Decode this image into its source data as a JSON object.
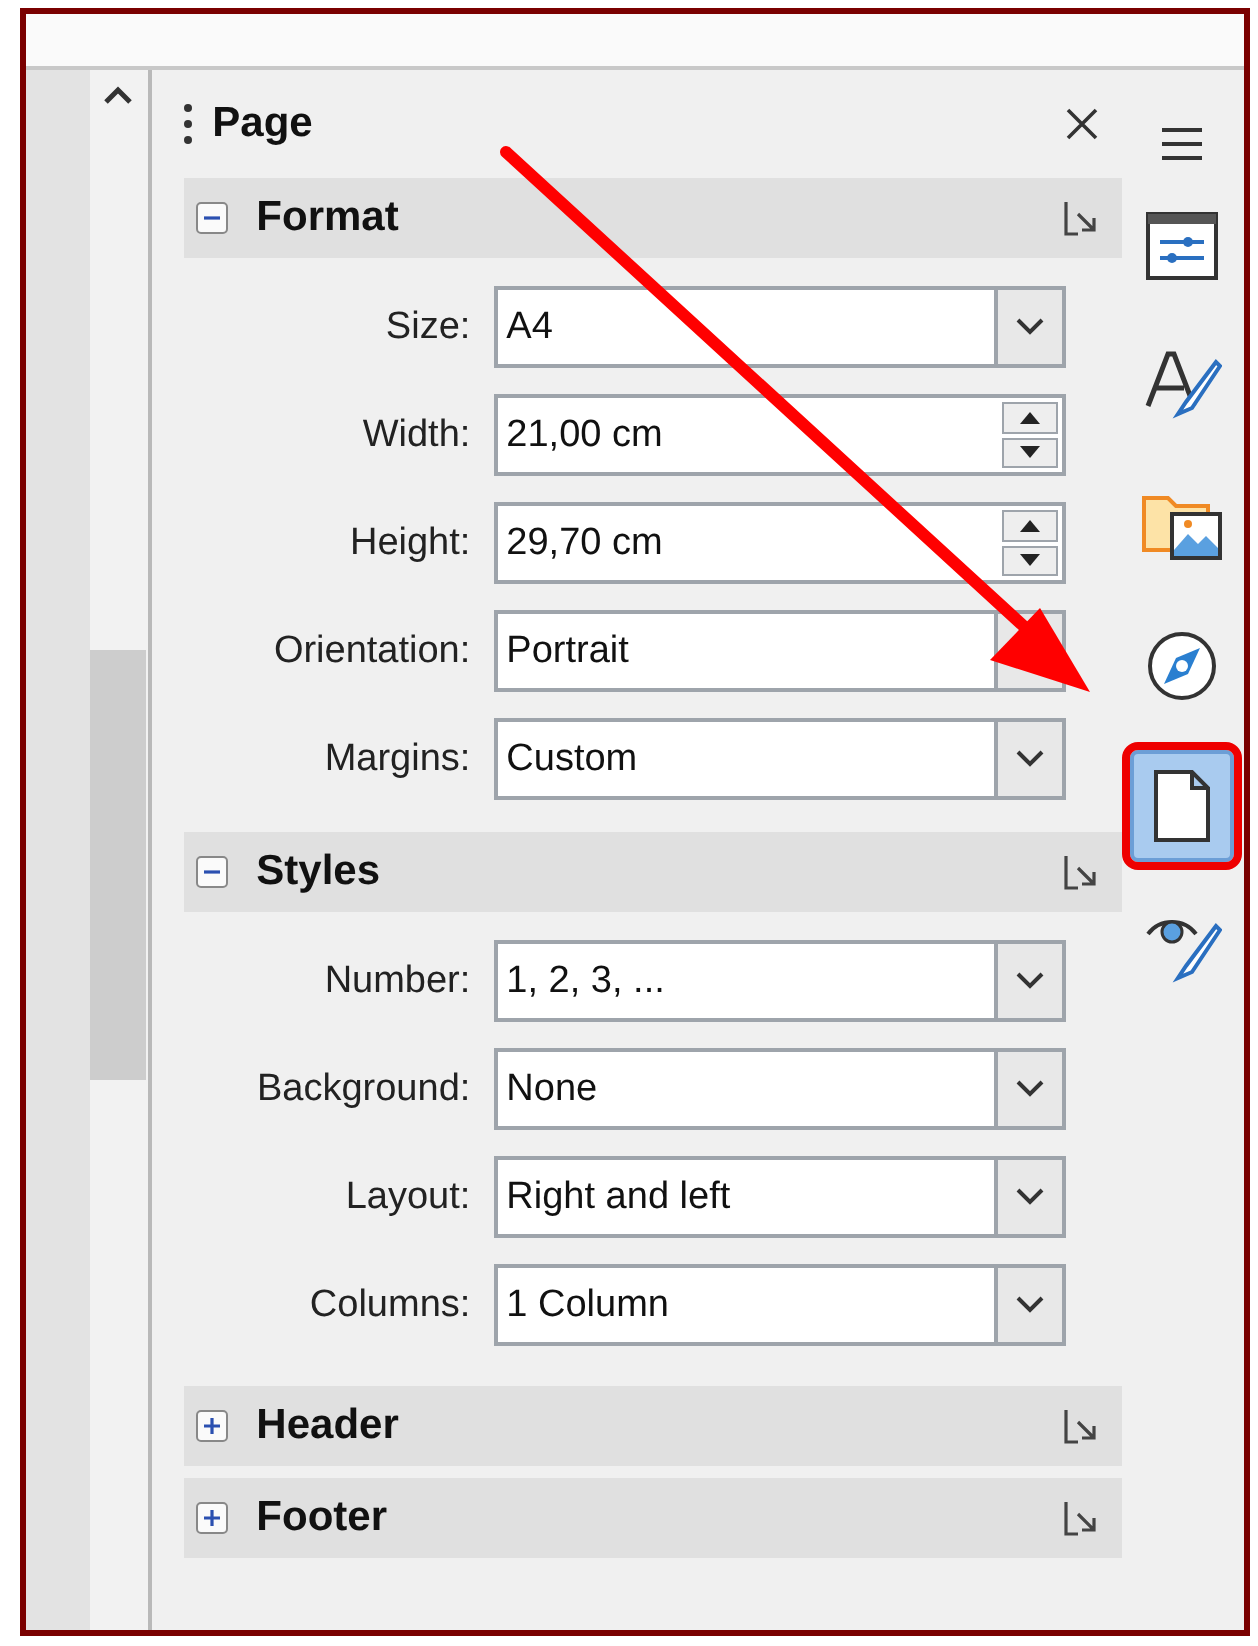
{
  "panel": {
    "title": "Page"
  },
  "sections": [
    {
      "title": "Format",
      "expanded": true,
      "fields": [
        {
          "label": "Size:",
          "value": "A4",
          "kind": "dropdown"
        },
        {
          "label": "Width:",
          "value": "21,00 cm",
          "kind": "spin"
        },
        {
          "label": "Height:",
          "value": "29,70 cm",
          "kind": "spin"
        },
        {
          "label": "Orientation:",
          "value": "Portrait",
          "kind": "dropdown"
        },
        {
          "label": "Margins:",
          "value": "Custom",
          "kind": "dropdown"
        }
      ]
    },
    {
      "title": "Styles",
      "expanded": true,
      "fields": [
        {
          "label": "Number:",
          "value": "1, 2, 3, ...",
          "kind": "dropdown"
        },
        {
          "label": "Background:",
          "value": "None",
          "kind": "dropdown"
        },
        {
          "label": "Layout:",
          "value": "Right and left",
          "kind": "dropdown"
        },
        {
          "label": "Columns:",
          "value": "1 Column",
          "kind": "dropdown"
        }
      ]
    },
    {
      "title": "Header",
      "expanded": false
    },
    {
      "title": "Footer",
      "expanded": false
    }
  ],
  "tabbar": [
    {
      "selected": false
    },
    {
      "selected": false
    },
    {
      "selected": false
    },
    {
      "selected": false
    },
    {
      "selected": true
    },
    {
      "selected": false
    }
  ]
}
